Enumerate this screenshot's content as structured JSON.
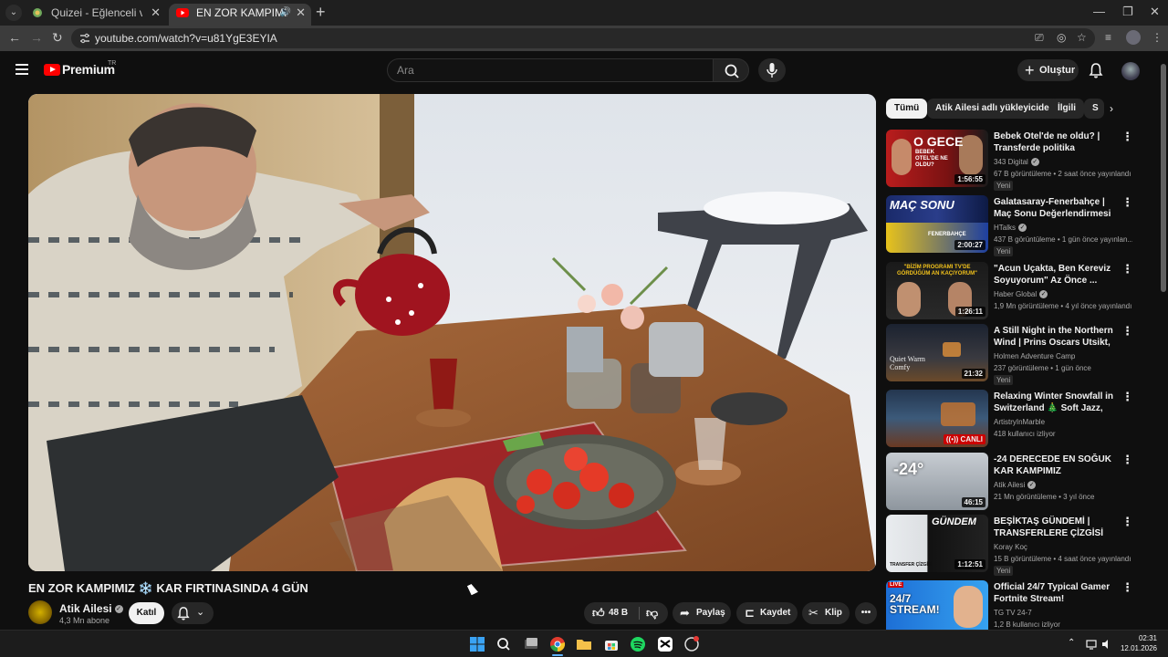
{
  "browser": {
    "tabs": [
      {
        "label": "Quizei - Eğlenceli ve etkileşimli",
        "active": false
      },
      {
        "label": "EN ZOR KAMPIMIZ ❄️ KAR",
        "active": true
      }
    ],
    "url": "youtube.com/watch?v=u81YgE3EYIA",
    "icons": [
      "back-icon",
      "forward-icon",
      "reload-icon",
      "cast-icon",
      "eye-off-icon",
      "bookmark-star-icon",
      "extensions-icon",
      "kebab-menu-icon"
    ]
  },
  "youtube": {
    "brand": "Premium",
    "country": "TR",
    "search_placeholder": "Ara",
    "create_label": "Oluştur",
    "accent": "#ff0000"
  },
  "video": {
    "title": "EN ZOR KAMPIMIZ ❄️ KAR FIRTINASINDA 4 GÜN",
    "channel": "Atik Ailesi",
    "subscribers": "4,3 Mn abone",
    "join_label": "Katıl",
    "likes": "48 B",
    "share_label": "Paylaş",
    "save_label": "Kaydet",
    "clip_label": "Klip"
  },
  "sidebar": {
    "chips": [
      "Tümü",
      "Atik Ailesi adlı yükleyiciden",
      "İlgili",
      "S"
    ],
    "recommendations": [
      {
        "title": "Bebek Otel'de ne oldu? | Transferde politika değişiyor ...",
        "channel": "343 Digital",
        "verified": true,
        "meta": "67 B görüntüleme • 2 saat önce yayınlandı",
        "badge": "Yeni",
        "duration": "1:56:55",
        "thumb_text": "O GECE",
        "thumb_sub": "BEBEK OTEL'DE NE OLDU?"
      },
      {
        "title": "Galatasaray-Fenerbahçe | Maç Sonu Değerlendirmesi",
        "channel": "HTalks",
        "verified": true,
        "meta": "437 B görüntüleme • 1 gün önce yayınlan...",
        "badge": "Yeni",
        "duration": "2:00:27",
        "thumb_text": "MAÇ SONU",
        "thumb_sub": "FENERBAHÇE"
      },
      {
        "title": "\"Acun Uçakta, Ben Kereviz Soyuyorum\" Az Önce ...",
        "channel": "Haber Global",
        "verified": true,
        "meta": "1,9 Mn görüntüleme • 4 yıl önce yayınlandı",
        "badge": "",
        "duration": "1:26:11",
        "thumb_text": "\"BİZİM PROGRAMI TV'DE GÖRDÜĞÜM AN KAÇIYORUM\"",
        "thumb_sub": ""
      },
      {
        "title": "A Still Night in the Northern Wind | Prins Oscars Utsikt, ...",
        "channel": "Holmen Adventure Camp",
        "verified": false,
        "meta": "237 görüntüleme • 1 gün önce",
        "badge": "Yeni",
        "duration": "21:32",
        "thumb_text": "Quiet Warm Comfy",
        "thumb_sub": ""
      },
      {
        "title": "Relaxing Winter Snowfall in Switzerland 🎄 Soft Jazz, Coz...",
        "channel": "ArtistryInMarble",
        "verified": false,
        "meta": "418 kullanıcı izliyor",
        "badge": "",
        "live": "CANLI",
        "thumb_text": "",
        "thumb_sub": ""
      },
      {
        "title": "-24 DERECEDE EN SOĞUK KAR KAMPIMIZ",
        "channel": "Atik Ailesi",
        "verified": true,
        "meta": "21 Mn görüntüleme • 3 yıl önce",
        "badge": "",
        "duration": "46:15",
        "thumb_text": "-24°",
        "thumb_sub": ""
      },
      {
        "title": "BEŞİKTAŞ GÜNDEMİ | TRANSFERLERE ÇİZGİSİ",
        "channel": "Koray Koç",
        "verified": false,
        "meta": "15 B görüntüleme • 4 saat önce yayınlandı",
        "badge": "Yeni",
        "duration": "1:12:51",
        "thumb_text": "GÜNDEM",
        "thumb_sub": "TRANSFER ÇİZGİSİ"
      },
      {
        "title": "Official 24/7 Typical Gamer Fortnite Stream!",
        "channel": "TG TV 24-7",
        "verified": false,
        "meta": "1,2 B kullanıcı izliyor",
        "badge": "",
        "thumb_text": "24/7 STREAM!",
        "thumb_sub": "LIVE"
      }
    ]
  },
  "taskbar": {
    "time": "02:31",
    "date": "12.01.2026",
    "apps": [
      "windows-start-icon",
      "search-icon",
      "task-view-icon",
      "chrome-icon",
      "file-explorer-icon",
      "store-icon",
      "spotify-icon",
      "capcut-icon",
      "app-icon"
    ]
  }
}
